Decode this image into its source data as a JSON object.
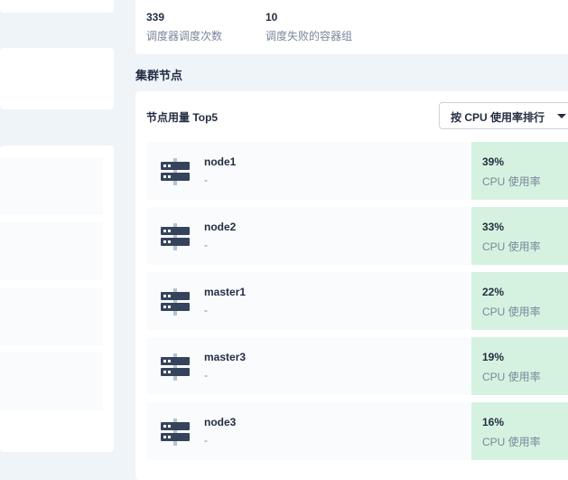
{
  "scheduler": {
    "stats": [
      {
        "value": "339",
        "label": "调度器调度次数"
      },
      {
        "value": "10",
        "label": "调度失败的容器组"
      }
    ]
  },
  "cluster_nodes": {
    "section_title": "集群节点",
    "card_title": "节点用量 Top5",
    "sort_select": {
      "selected": "按 CPU 使用率排行"
    },
    "nodes": [
      {
        "name": "node1",
        "subtitle": "-",
        "value": "39%",
        "metric_label": "CPU 使用率"
      },
      {
        "name": "node2",
        "subtitle": "-",
        "value": "33%",
        "metric_label": "CPU 使用率"
      },
      {
        "name": "master1",
        "subtitle": "-",
        "value": "22%",
        "metric_label": "CPU 使用率"
      },
      {
        "name": "master3",
        "subtitle": "-",
        "value": "19%",
        "metric_label": "CPU 使用率"
      },
      {
        "name": "node3",
        "subtitle": "-",
        "value": "16%",
        "metric_label": "CPU 使用率"
      }
    ]
  },
  "icons": {
    "node": "server-icon",
    "sort": "caret-down-icon"
  },
  "colors": {
    "page_background": "#eff4f9",
    "card_background": "#ffffff",
    "row_background": "#f9fbfd",
    "metric_background": "#d5f2e0",
    "text_primary": "#242e42",
    "text_secondary": "#79879c",
    "icon": "#36435c"
  }
}
